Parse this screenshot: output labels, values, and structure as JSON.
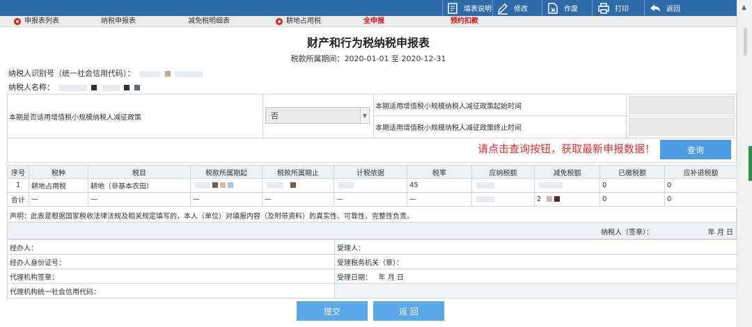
{
  "toolbar": {
    "fill_help": "填表说明",
    "modify": "修改",
    "void": "作废",
    "print": "打印",
    "back": "返回"
  },
  "menu": {
    "items": [
      "申报表列表",
      "纳税申报表",
      "减免税明细表",
      "耕地占用税",
      "全申报",
      "预约扣款"
    ]
  },
  "form": {
    "title": "财产和行为税纳税申报表",
    "period_label": "税款所属期间：",
    "period_value": "2020-01-01 至 2020-12-31",
    "taxpayer_id_label": "纳税人识别号（统一社会信用代码）：",
    "taxpayer_name_label": "纳税人名称："
  },
  "policy": {
    "question": "本期是否适用增值税小规模纳税人减征政策",
    "select_value": "否",
    "start_label": "本期适用增值税小规模纳税人减征政策起始时间",
    "end_label": "本期适用增值税小规模纳税人减征政策终止时间"
  },
  "query": {
    "hint": "请点击查询按钮，获取最新申报数据！",
    "button": "查询"
  },
  "table": {
    "headers": [
      "序号",
      "税种",
      "税目",
      "税款所属期起",
      "税款所属期止",
      "计税依据",
      "税率",
      "应纳税额",
      "减免税额",
      "已缴税额",
      "应补退税额"
    ],
    "row1": {
      "no": "1",
      "tax_type": "耕地占用税",
      "item": "耕地（非基本农田）",
      "rate": "45",
      "paid": "0",
      "refund": "0"
    },
    "total": {
      "label": "合计",
      "dash": "—",
      "paid": "0",
      "refund": "0",
      "reduce_prefix": "2"
    }
  },
  "declaration": "声明：此表是根据国家税收法律法规及相关规定填写的，本人（单位）对填报内容（及附带资料）的真实性、可靠性、完整性负责。",
  "sign": {
    "label": "纳税人（签章）：",
    "date": "年  月  日"
  },
  "bottom": {
    "agent": "经办人：",
    "receiver": "受理人：",
    "agent_id": "经办人身份证号：",
    "receiving_office": "受理税务机关（章）：",
    "agency_seal": "代理机构签章：",
    "receive_date_label": "受理日期：",
    "receive_date_value": "年  月  日",
    "agency_code": "代理机构统一社会信用代码："
  },
  "actions": {
    "submit": "提交",
    "back": "返 回"
  },
  "colors": {
    "toolbar": "#2e6aaa",
    "accent_button": "#4d9be2",
    "hint_red": "#e23030",
    "menu_red": "#dd1111"
  }
}
